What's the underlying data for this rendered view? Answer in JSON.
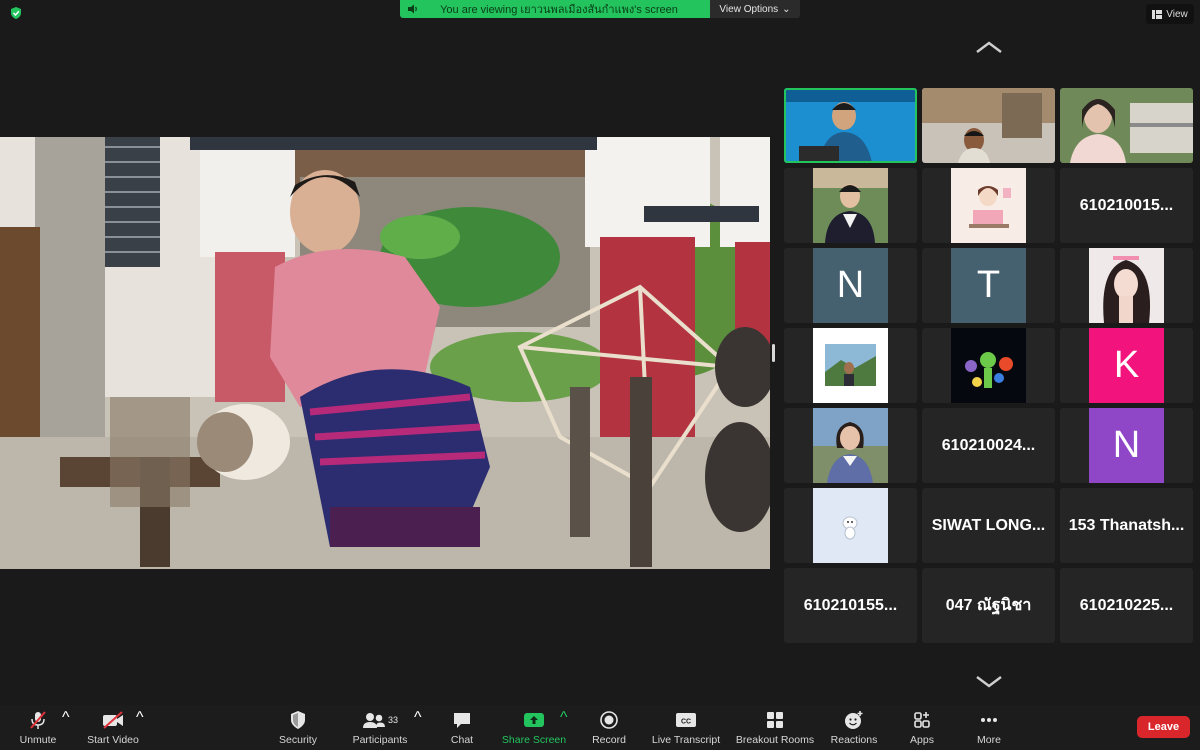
{
  "banner": {
    "text": "You are viewing เยาวนพลเมืองสันกำแพง's screen",
    "view_options": "View Options"
  },
  "view_button": "View",
  "gallery": {
    "tiles": [
      {
        "type": "video",
        "id": "host"
      },
      {
        "type": "video",
        "id": "student-room"
      },
      {
        "type": "video",
        "id": "woman-glasses"
      },
      {
        "type": "photo",
        "id": "grad-photo"
      },
      {
        "type": "photo",
        "id": "cartoon-girl"
      },
      {
        "type": "name",
        "text": "610210015..."
      },
      {
        "type": "letter",
        "text": "N",
        "color": "#45606e"
      },
      {
        "type": "letter",
        "text": "T",
        "color": "#45606e"
      },
      {
        "type": "photo",
        "id": "girl-portrait"
      },
      {
        "type": "photo",
        "id": "landscape-selfie"
      },
      {
        "type": "photo",
        "id": "inside-out"
      },
      {
        "type": "letter",
        "text": "K",
        "color": "#f3137c"
      },
      {
        "type": "photo",
        "id": "student-girl"
      },
      {
        "type": "name",
        "text": "610210024..."
      },
      {
        "type": "letter",
        "text": "N",
        "color": "#8f47c7"
      },
      {
        "type": "photo",
        "id": "sticker"
      },
      {
        "type": "name",
        "text": "SIWAT LONG..."
      },
      {
        "type": "name",
        "text": "153 Thanatsh..."
      },
      {
        "type": "name",
        "text": "610210155..."
      },
      {
        "type": "name",
        "text": "047 ณัฐนิชา"
      },
      {
        "type": "name",
        "text": "610210225..."
      }
    ]
  },
  "toolbar": {
    "unmute": "Unmute",
    "start_video": "Start Video",
    "security": "Security",
    "participants": "Participants",
    "participants_count": "33",
    "chat": "Chat",
    "share_screen": "Share Screen",
    "record": "Record",
    "live_transcript": "Live Transcript",
    "breakout_rooms": "Breakout Rooms",
    "reactions": "Reactions",
    "apps": "Apps",
    "more": "More",
    "leave": "Leave"
  },
  "colors": {
    "accent_green": "#23c45e",
    "leave_red": "#d8262b"
  }
}
